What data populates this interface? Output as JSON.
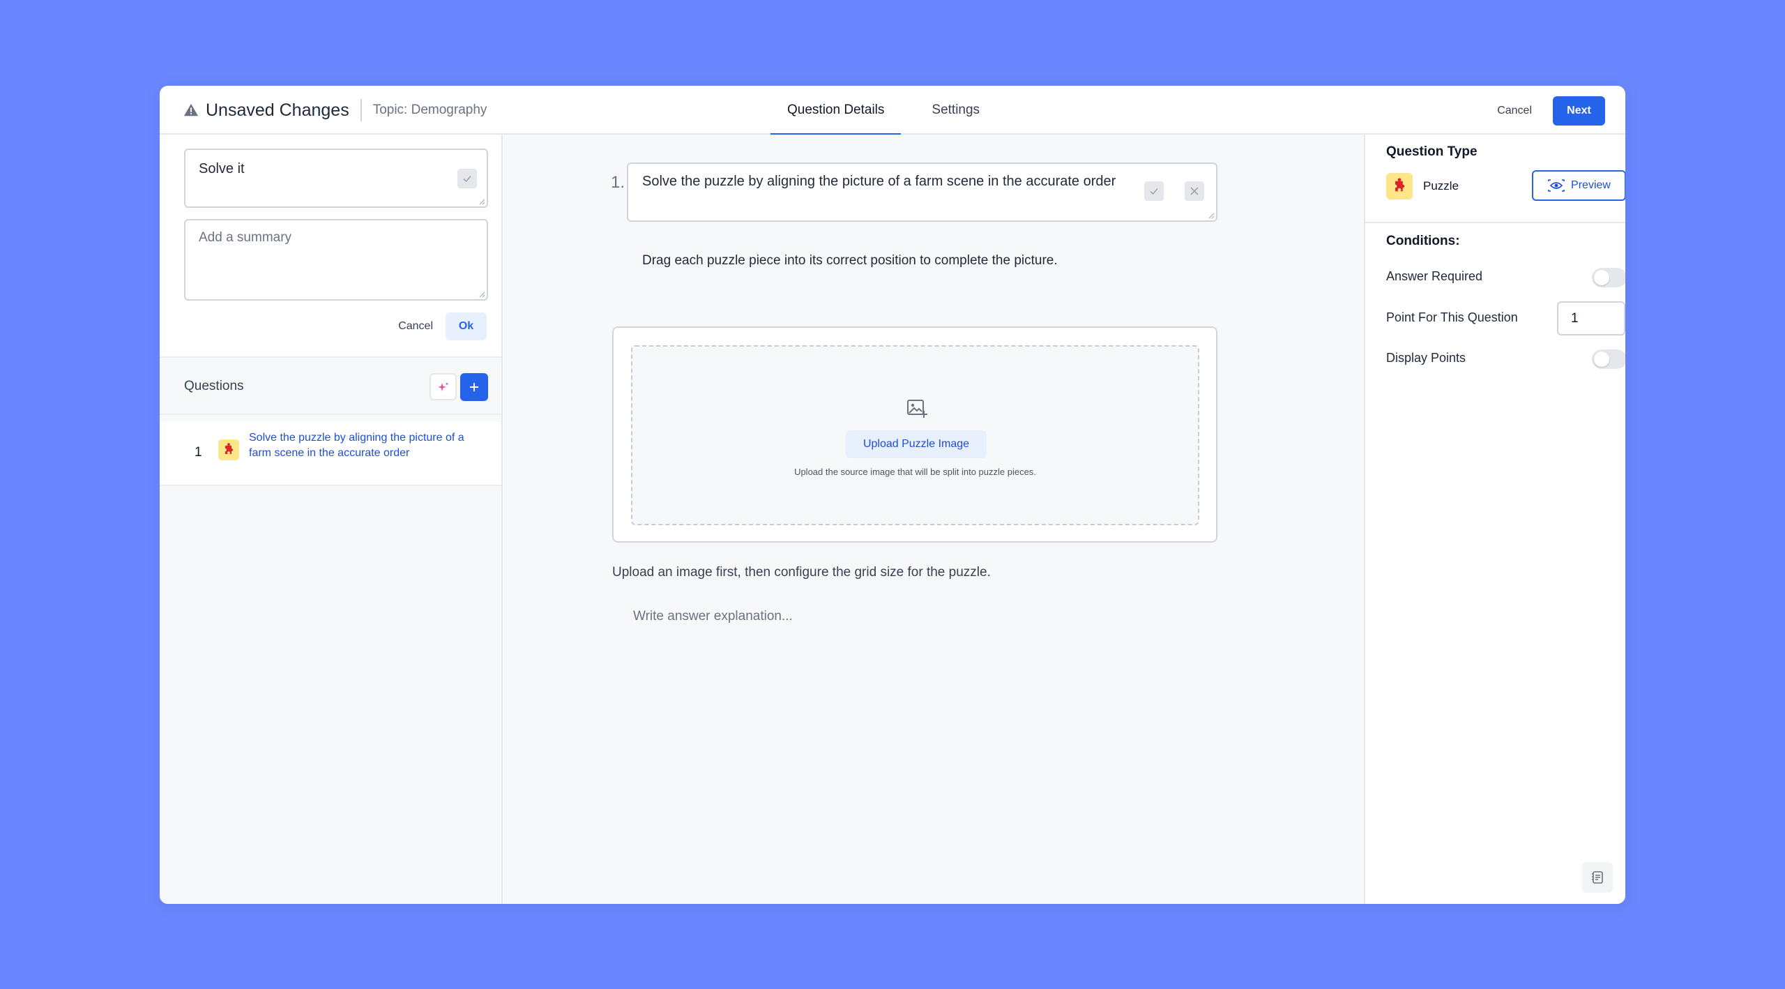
{
  "header": {
    "title": "Unsaved Changes",
    "topic": "Topic: Demography",
    "tabs": [
      {
        "label": "Question Details",
        "active": true
      },
      {
        "label": "Settings",
        "active": false
      }
    ],
    "cancel_label": "Cancel",
    "next_label": "Next"
  },
  "left_panel": {
    "title_value": "Solve it",
    "summary_placeholder": "Add a summary",
    "cancel_label": "Cancel",
    "ok_label": "Ok",
    "questions_label": "Questions",
    "questions": [
      {
        "number": "1",
        "text": "Solve the puzzle by aligning the picture of a farm scene in the accurate order"
      }
    ]
  },
  "editor": {
    "question_number": "1.",
    "question_text": "Solve the puzzle by aligning the picture of a farm scene in the accurate order",
    "instruction": "Drag each puzzle piece into its correct position to complete the picture.",
    "upload_button": "Upload Puzzle Image",
    "upload_hint": "Upload the source image that will be split into puzzle pieces.",
    "grid_note": "Upload an image first, then configure the grid size for the puzzle.",
    "explanation_placeholder": "Write answer explanation..."
  },
  "right_panel": {
    "question_type_label": "Question Type",
    "question_type": "Puzzle",
    "preview_label": "Preview",
    "conditions_label": "Conditions:",
    "answer_required_label": "Answer Required",
    "answer_required": false,
    "points_label": "Point For This Question",
    "points_value": "1",
    "display_points_label": "Display Points",
    "display_points": false
  },
  "colors": {
    "background": "#6b87ff",
    "primary": "#2563eb",
    "puzzle_icon_bg": "#fde68a",
    "puzzle_icon": "#dc2626"
  }
}
